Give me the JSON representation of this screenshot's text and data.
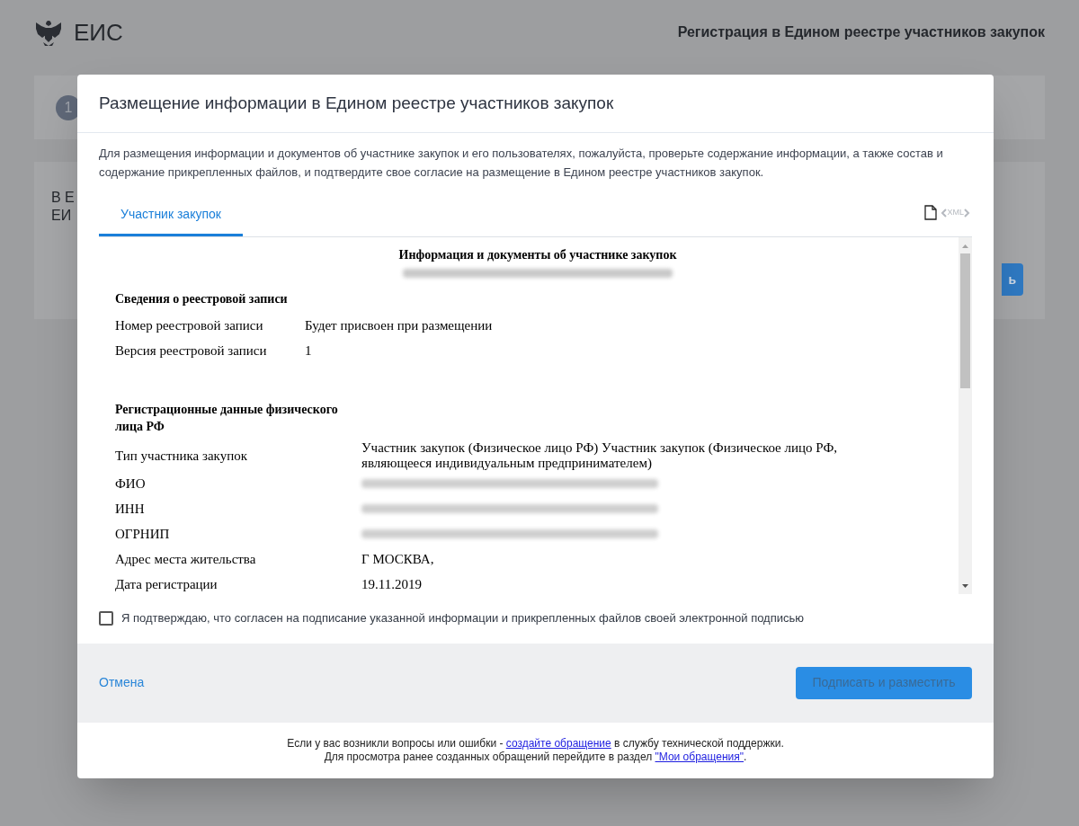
{
  "background": {
    "logo_text": "ЕИС",
    "page_title": "Регистрация в Едином реестре участников закупок",
    "step_number": "1",
    "card_fragments": [
      "В Е",
      "ЕИ"
    ],
    "button_fragment": "ь"
  },
  "modal": {
    "title": "Размещение информации в Едином реестре участников закупок",
    "description": "Для размещения информации и документов об участнике закупок и его пользователях, пожалуйста, проверьте содержание информации, а также состав и содержание прикрепленных файлов, и подтвердите свое согласие на размещение в Едином реестре участников закупок.",
    "tabs": [
      {
        "label": "Участник закупок",
        "selected": true
      }
    ],
    "xml_label": "XML",
    "document": {
      "title": "Информация и документы об участнике закупок",
      "sections": [
        {
          "heading": "Сведения о реестровой записи",
          "rows": [
            {
              "label": "Номер реестровой записи",
              "kind": "text",
              "value": "Будет присвоен при размещении"
            },
            {
              "label": "Версия реестровой записи",
              "kind": "text",
              "value": "1"
            }
          ]
        },
        {
          "heading": "Регистрационные данные физического лица РФ",
          "rows": [
            {
              "label": "Тип участника закупок",
              "kind": "text",
              "value": "Участник закупок (Физическое лицо РФ)  Участник закупок (Физическое лицо РФ, являющееся индивидуальным предпринимателем)"
            },
            {
              "label": "ФИО",
              "kind": "blurred"
            },
            {
              "label": "ИНН",
              "kind": "blurred"
            },
            {
              "label": "ОГРНИП",
              "kind": "blurred"
            },
            {
              "label": "Адрес места жительства",
              "kind": "text",
              "value": "Г МОСКВА,"
            },
            {
              "label": "Дата регистрации",
              "kind": "text",
              "value": "19.11.2019"
            }
          ]
        }
      ]
    },
    "consent": {
      "label": "Я подтверждаю, что согласен на подписание указанной информации и прикрепленных файлов своей электронной подписью",
      "checked": false
    },
    "cancel": "Отмена",
    "submit": {
      "label": "Подписать и разместить",
      "disabled": true
    },
    "help_lines": [
      {
        "before": "Если у вас возникли вопросы или ошибки - ",
        "link": "создайте обращение",
        "after": " в службу технической поддержки."
      },
      {
        "before": "Для просмотра ранее созданных обращений перейдите в раздел ",
        "link": "\"Мои обращения\"",
        "after": "."
      }
    ]
  }
}
